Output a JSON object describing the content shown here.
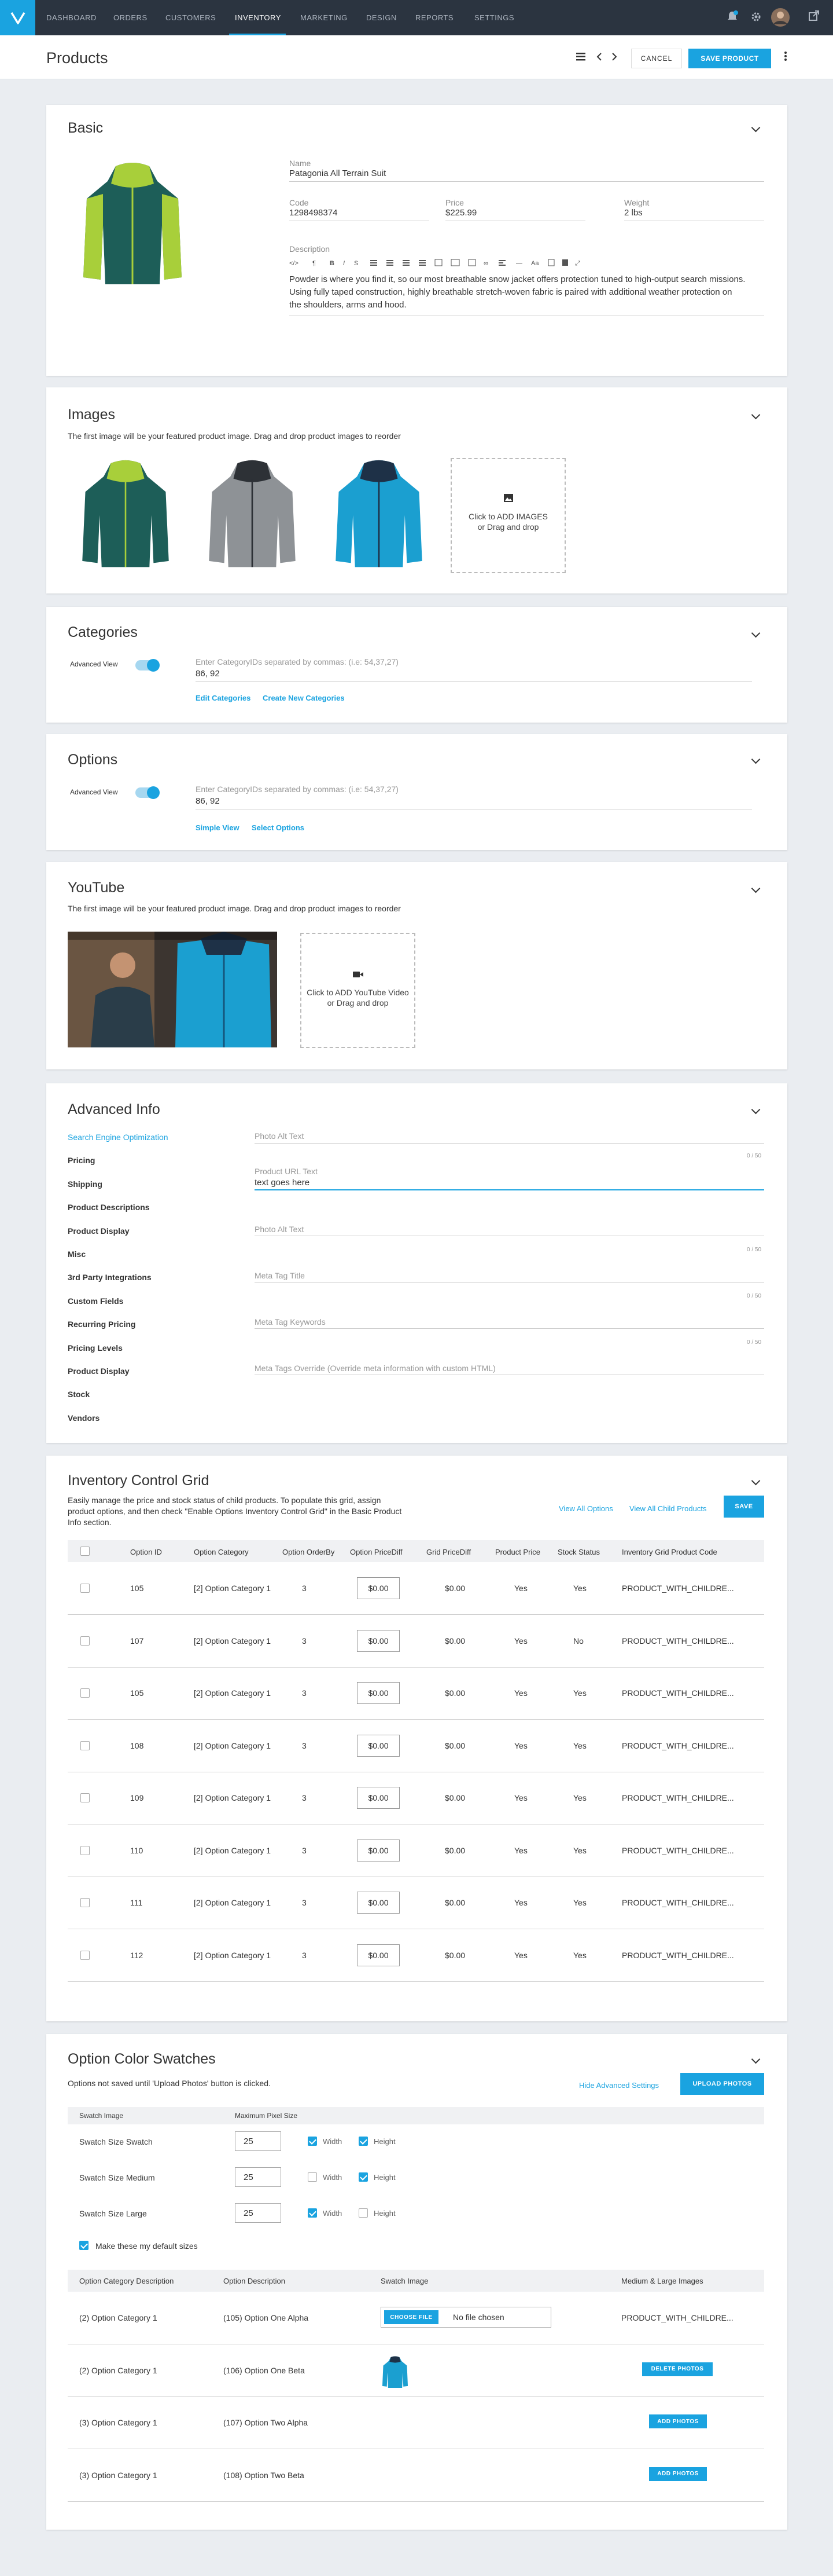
{
  "nav": {
    "items": [
      "DASHBOARD",
      "ORDERS",
      "CUSTOMERS",
      "INVENTORY",
      "MARKETING",
      "DESIGN",
      "REPORTS",
      "SETTINGS"
    ],
    "active": "INVENTORY"
  },
  "header": {
    "title": "Products",
    "cancel_label": "CANCEL",
    "save_label": "SAVE PRODUCT"
  },
  "basic": {
    "title": "Basic",
    "name_label": "Name",
    "name_value": "Patagonia All Terrain Suit",
    "code_label": "Code",
    "code_value": "1298498374",
    "price_label": "Price",
    "price_value": "$225.99",
    "weight_label": "Weight",
    "weight_value": "2 lbs",
    "description_label": "Description",
    "description_text": "Powder is where you find it, so our most breathable snow jacket offers protection tuned to high-output search missions. Using fully taped construction, highly breathable stretch-woven fabric is paired with additional weather protection on the shoulders, arms and hood."
  },
  "images": {
    "title": "Images",
    "hint": "The first image will be your featured product image. Drag and drop product images to reorder",
    "add_line1": "Click to ADD IMAGES",
    "add_line2": "or Drag and drop",
    "jacket_colors": [
      {
        "body": "#1d5e58",
        "accent": "#a8cf3a"
      },
      {
        "body": "#8e9296",
        "accent": "#2d3136"
      },
      {
        "body": "#1b9fd0",
        "accent": "#1e3147"
      }
    ]
  },
  "categories": {
    "title": "Categories",
    "advanced_view_label": "Advanced View",
    "hint": "Enter CategoryIDs separated by commas: (i.e: 54,37,27)",
    "value": "86, 92",
    "edit_link": "Edit Categories",
    "create_link": "Create New Categories"
  },
  "options": {
    "title": "Options",
    "advanced_view_label": "Advanced View",
    "hint": "Enter CategoryIDs separated by commas: (i.e: 54,37,27)",
    "value": "86, 92",
    "simple_link": "Simple View",
    "select_link": "Select Options"
  },
  "youtube": {
    "title": "YouTube",
    "hint": "The first image will be your featured product image. Drag and drop product images to reorder",
    "add_line1": "Click to ADD YouTube Video",
    "add_line2": "or Drag and drop"
  },
  "advanced": {
    "title": "Advanced Info",
    "side_items": [
      "Search Engine Optimization",
      "Pricing",
      "Shipping",
      "Product Descriptions",
      "Product Display",
      "Misc",
      "3rd Party Integrations",
      "Custom Fields",
      "Recurring Pricing",
      "Pricing Levels",
      "Product Display",
      "Stock",
      "Vendors"
    ],
    "photo_alt_1": "Photo Alt Text",
    "counter_1": "0 / 50",
    "url_label": "Product URL Text",
    "url_value": "text goes here",
    "photo_alt_2": "Photo Alt Text",
    "counter_2": "0 / 50",
    "meta_title": "Meta Tag Title",
    "counter_3": "0 / 50",
    "meta_keywords": "Meta Tag Keywords",
    "counter_4": "0 / 50",
    "meta_override": "Meta Tags Override (Override meta information with custom HTML)"
  },
  "inventory": {
    "title": "Inventory Control Grid",
    "desc_line1": "Easily manage the price and stock status of child products. To populate this grid, assign",
    "desc_line2": "product options, and then check \"Enable Options Inventory Control Grid\" in the Basic Product",
    "desc_line3": "Info section.",
    "view_all_options": "View All Options",
    "view_all_child": "View All Child Products",
    "save_label": "SAVE",
    "headers": [
      "Option ID",
      "Option Category",
      "Option OrderBy",
      "Option PriceDiff",
      "Grid PriceDiff",
      "Product Price",
      "Stock Status",
      "Inventory Grid Product Code"
    ],
    "rows": [
      {
        "id": "105",
        "cat": "[2] Option Category 1",
        "order": "3",
        "opd": "$0.00",
        "gpd": "$0.00",
        "pp": "Yes",
        "stock": "Yes",
        "code": "PRODUCT_WITH_CHILDRE..."
      },
      {
        "id": "107",
        "cat": "[2] Option Category 1",
        "order": "3",
        "opd": "$0.00",
        "gpd": "$0.00",
        "pp": "Yes",
        "stock": "No",
        "code": "PRODUCT_WITH_CHILDRE..."
      },
      {
        "id": "105",
        "cat": "[2] Option Category 1",
        "order": "3",
        "opd": "$0.00",
        "gpd": "$0.00",
        "pp": "Yes",
        "stock": "Yes",
        "code": "PRODUCT_WITH_CHILDRE..."
      },
      {
        "id": "108",
        "cat": "[2] Option Category 1",
        "order": "3",
        "opd": "$0.00",
        "gpd": "$0.00",
        "pp": "Yes",
        "stock": "Yes",
        "code": "PRODUCT_WITH_CHILDRE..."
      },
      {
        "id": "109",
        "cat": "[2] Option Category 1",
        "order": "3",
        "opd": "$0.00",
        "gpd": "$0.00",
        "pp": "Yes",
        "stock": "Yes",
        "code": "PRODUCT_WITH_CHILDRE..."
      },
      {
        "id": "110",
        "cat": "[2] Option Category 1",
        "order": "3",
        "opd": "$0.00",
        "gpd": "$0.00",
        "pp": "Yes",
        "stock": "Yes",
        "code": "PRODUCT_WITH_CHILDRE..."
      },
      {
        "id": "111",
        "cat": "[2] Option Category 1",
        "order": "3",
        "opd": "$0.00",
        "gpd": "$0.00",
        "pp": "Yes",
        "stock": "Yes",
        "code": "PRODUCT_WITH_CHILDRE..."
      },
      {
        "id": "112",
        "cat": "[2] Option Category 1",
        "order": "3",
        "opd": "$0.00",
        "gpd": "$0.00",
        "pp": "Yes",
        "stock": "Yes",
        "code": "PRODUCT_WITH_CHILDRE..."
      }
    ]
  },
  "swatches": {
    "title": "Option Color Swatches",
    "note": "Options not saved until 'Upload Photos' button is clicked.",
    "hide_link": "Hide Advanced Settings",
    "upload_label": "UPLOAD PHOTOS",
    "col_image": "Swatch Image",
    "col_size": "Maximum Pixel Size",
    "width_label": "Width",
    "height_label": "Height",
    "sizes": [
      {
        "name": "Swatch Size Swatch",
        "value": "25",
        "width": true,
        "height": true
      },
      {
        "name": "Swatch Size Medium",
        "value": "25",
        "width": false,
        "height": true
      },
      {
        "name": "Swatch Size Large",
        "value": "25",
        "width": true,
        "height": false
      }
    ],
    "default_label": "Make these my default sizes",
    "headers": [
      "Option Category Description",
      "Option Description",
      "Swatch Image",
      "Medium & Large Images"
    ],
    "rows": [
      {
        "cat": "(2) Option Category 1",
        "desc": "(105) Option One Alpha",
        "choose_label": "CHOOSE FILE",
        "file_status": "No file chosen",
        "right": "PRODUCT_WITH_CHILDRE..."
      },
      {
        "cat": "(2) Option Category 1",
        "desc": "(106) Option One Beta",
        "right": "DELETE PHOTOS"
      },
      {
        "cat": "(3) Option Category 1",
        "desc": "(107) Option Two Alpha",
        "right": "ADD PHOTOS"
      },
      {
        "cat": "(3) Option Category 1",
        "desc": "(108) Option Two Beta",
        "right": "ADD PHOTOS"
      }
    ]
  }
}
